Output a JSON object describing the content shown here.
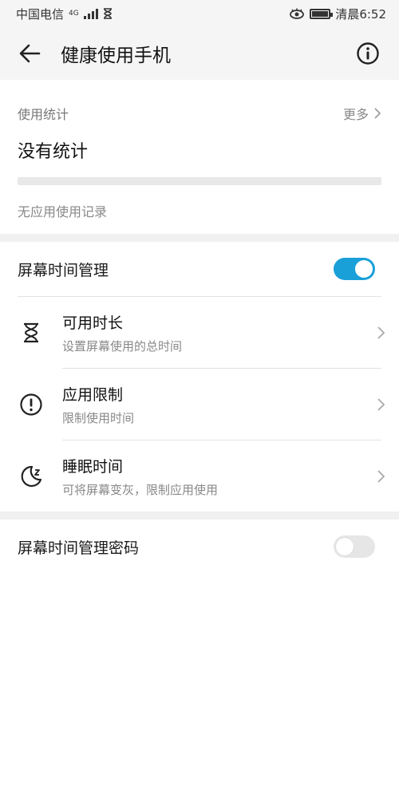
{
  "status_bar": {
    "carrier": "中国电信",
    "network": "4G",
    "time": "清晨6:52"
  },
  "app_bar": {
    "title": "健康使用手机",
    "back_icon": "arrow-left-icon",
    "info_icon": "info-circle-icon"
  },
  "usage_stats": {
    "label": "使用统计",
    "more": "更多",
    "title": "没有统计",
    "progress": 0,
    "note": "无应用使用记录"
  },
  "screen_time": {
    "label": "屏幕时间管理",
    "enabled": true,
    "accent": "#1aa0d8",
    "items": [
      {
        "title": "可用时长",
        "subtitle": "设置屏幕使用的总时间",
        "icon": "hourglass-icon"
      },
      {
        "title": "应用限制",
        "subtitle": "限制使用时间",
        "icon": "alert-circle-icon"
      },
      {
        "title": "睡眠时间",
        "subtitle": "可将屏幕变灰，限制应用使用",
        "icon": "moon-icon"
      }
    ]
  },
  "password": {
    "label": "屏幕时间管理密码",
    "enabled": false
  }
}
